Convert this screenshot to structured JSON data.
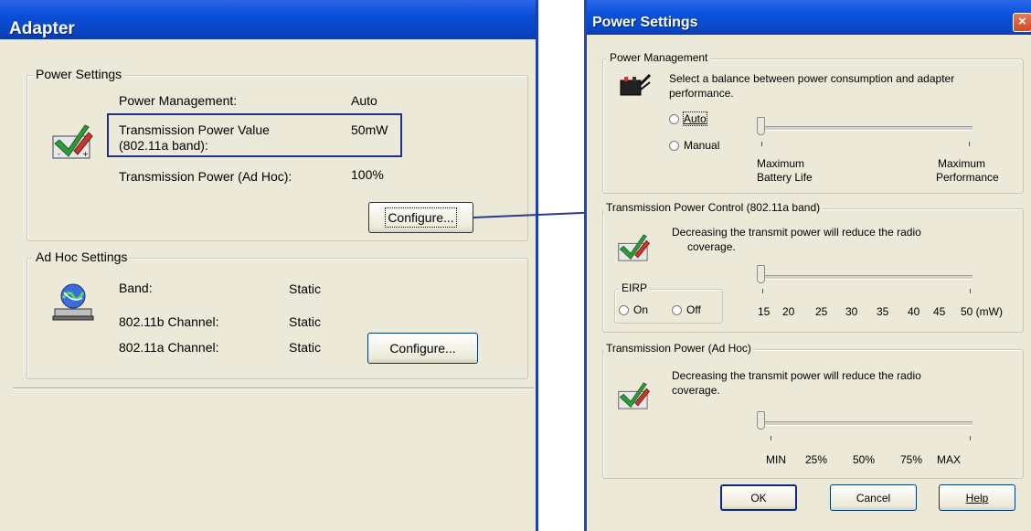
{
  "adapter": {
    "title": "Adapter",
    "power_settings": {
      "group_label": "Power Settings",
      "rows": [
        {
          "label": "Power Management:",
          "value": "Auto"
        },
        {
          "label": "Transmission Power Value",
          "label2": "(802.11a band):",
          "value": "50mW"
        },
        {
          "label": "Transmission Power (Ad Hoc):",
          "value": "100%"
        }
      ],
      "configure_label": "Configure..."
    },
    "adhoc_settings": {
      "group_label": "Ad Hoc Settings",
      "rows": [
        {
          "label": "Band:",
          "value": "Static"
        },
        {
          "label": "802.11b Channel:",
          "value": "Static"
        },
        {
          "label": "802.11a Channel:",
          "value": "Static"
        }
      ],
      "configure_label": "Configure..."
    }
  },
  "power_dialog": {
    "title": "Power Settings",
    "close_label": "×",
    "power_management": {
      "group_label": "Power Management",
      "description": "Select a balance between power consumption and adapter",
      "description2": "performance.",
      "radio_auto": "Auto",
      "radio_manual": "Manual",
      "left_label": "Maximum",
      "left_label2": "Battery Life",
      "right_label": "Maximum",
      "right_label2": "Performance"
    },
    "tx_power_control": {
      "group_label": "Transmission Power Control (802.11a band)",
      "description": "Decreasing the transmit power will reduce the radio",
      "description2": "coverage.",
      "eirp_label": "EIRP",
      "eirp_on": "On",
      "eirp_off": "Off",
      "scale": [
        "15",
        "20",
        "25",
        "30",
        "35",
        "40",
        "45",
        "50 (mW)"
      ],
      "value_mw": 15
    },
    "tx_power_adhoc": {
      "group_label": "Transmission Power (Ad Hoc)",
      "description": "Decreasing the transmit power will reduce the radio",
      "description2": "coverage.",
      "scale": [
        "MIN",
        "25%",
        "50%",
        "75%",
        "MAX"
      ]
    },
    "buttons": {
      "ok": "OK",
      "cancel": "Cancel",
      "help": "Help"
    }
  },
  "colors": {
    "highlight_box": "#1f2f8f",
    "connector": "#2a3a8c",
    "dialog_bg": "#ece9d8",
    "titlebar": "#0a4fd6"
  }
}
